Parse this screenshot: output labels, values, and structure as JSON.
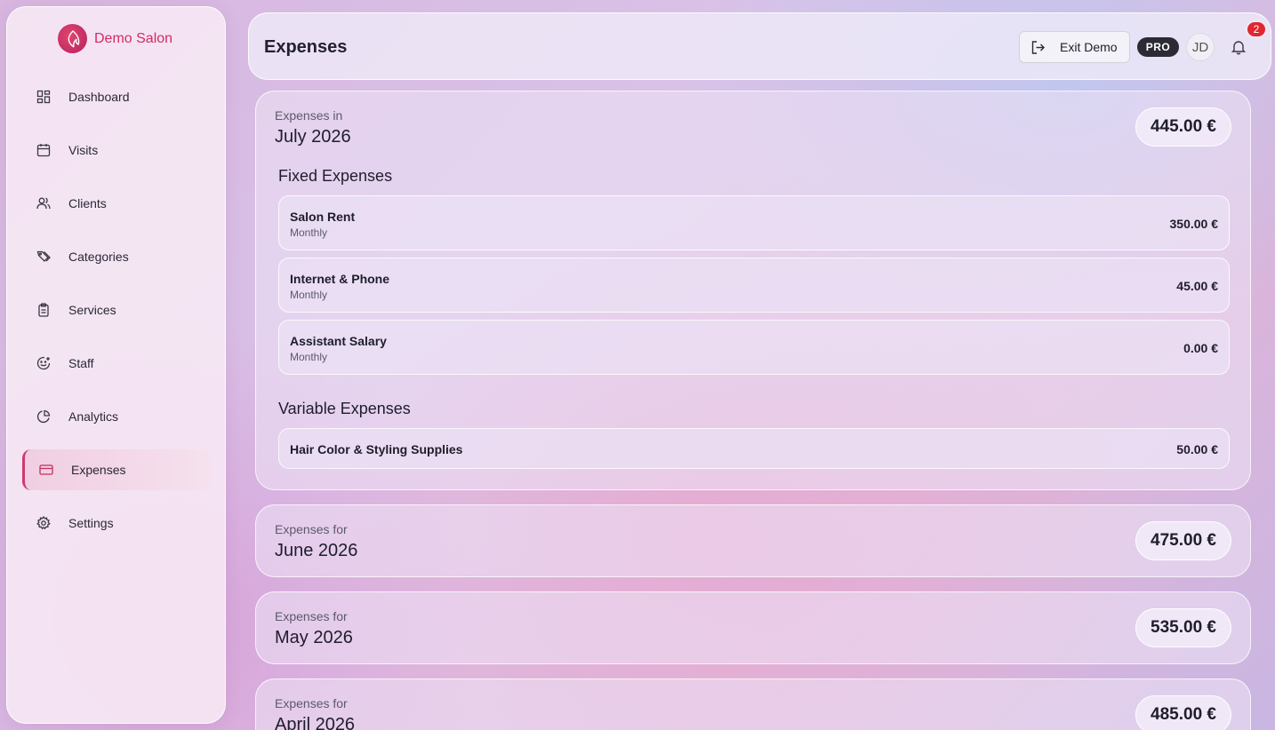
{
  "brand": {
    "name": "Demo Salon"
  },
  "sidebar": {
    "items": [
      {
        "label": "Dashboard",
        "icon": "dashboard-icon"
      },
      {
        "label": "Visits",
        "icon": "calendar-icon"
      },
      {
        "label": "Clients",
        "icon": "users-icon"
      },
      {
        "label": "Categories",
        "icon": "tags-icon"
      },
      {
        "label": "Services",
        "icon": "clipboard-icon"
      },
      {
        "label": "Staff",
        "icon": "smile-plus-icon"
      },
      {
        "label": "Analytics",
        "icon": "pie-chart-icon"
      },
      {
        "label": "Expenses",
        "icon": "credit-card-icon",
        "active": true
      },
      {
        "label": "Settings",
        "icon": "gear-icon"
      }
    ]
  },
  "header": {
    "title": "Expenses",
    "exit_label": "Exit Demo",
    "plan_badge": "PRO",
    "avatar_initials": "JD",
    "notification_count": "2"
  },
  "current_month": {
    "label": "Expenses in",
    "month": "July 2026",
    "total": "445.00 €",
    "fixed": {
      "heading": "Fixed Expenses",
      "items": [
        {
          "name": "Salon Rent",
          "frequency": "Monthly",
          "amount": "350.00 €"
        },
        {
          "name": "Internet & Phone",
          "frequency": "Monthly",
          "amount": "45.00 €"
        },
        {
          "name": "Assistant Salary",
          "frequency": "Monthly",
          "amount": "0.00 €"
        }
      ]
    },
    "variable": {
      "heading": "Variable Expenses",
      "items": [
        {
          "name": "Hair Color & Styling Supplies",
          "amount": "50.00 €"
        }
      ]
    }
  },
  "past_months": [
    {
      "label": "Expenses for",
      "month": "June 2026",
      "total": "475.00 €"
    },
    {
      "label": "Expenses for",
      "month": "May 2026",
      "total": "535.00 €"
    },
    {
      "label": "Expenses for",
      "month": "April 2026",
      "total": "485.00 €"
    }
  ],
  "colors": {
    "accent": "#d42a64",
    "badge_dark": "#2b2a35",
    "notification": "#e0262f"
  }
}
